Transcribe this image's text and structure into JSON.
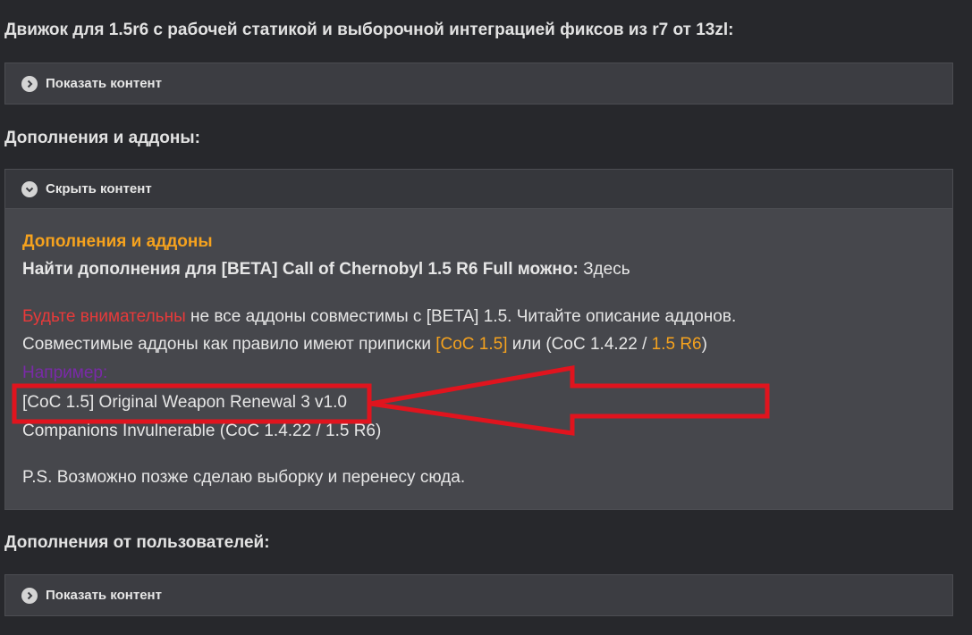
{
  "section1": {
    "heading": "Движок для 1.5r6 с рабочей статикой и выборочной интеграцией фиксов из r7 от 13zl:",
    "spoiler_label": "Показать контент"
  },
  "section2": {
    "heading": "Дополнения и аддоны:",
    "spoiler_label": "Скрыть контент",
    "content": {
      "title": "Дополнения и аддоны",
      "find_line": "Найти дополнения для [BETA] Call of Chernobyl 1.5 R6 Full можно:",
      "find_link": "Здесь",
      "warn_red": "Будьте внимательны",
      "warn_rest": " не все аддоны совместимы с [BETA] 1.5. Читайте описание аддонов.",
      "compat_text": "Совместимые аддоны как правило имеют приписки ",
      "compat_tag1": "[CoC 1.5]",
      "compat_mid": " или (CoC 1.4.22 / ",
      "compat_tag2": "1.5 R6",
      "compat_end": ")",
      "example_label": "Например:",
      "example1": "[CoC 1.5] Original Weapon Renewal 3 v1.0",
      "example2": "Companions Invulnerable (CoC 1.4.22 / 1.5 R6)",
      "ps": "P.S. Возможно позже сделаю выборку и перенесу сюда."
    }
  },
  "section3": {
    "heading": "Дополнения от пользователей:",
    "spoiler_label": "Показать контент"
  },
  "colors": {
    "background": "#27282c",
    "spoiler_bg": "#3c3d42",
    "content_bg": "#46474c",
    "orange": "#f5a21e",
    "red_text": "#e83a3a",
    "purple_text": "#7a2aa8",
    "annotation_red": "#e0141e"
  },
  "icons": {
    "spoiler_closed": "chevron-right-circle-icon",
    "spoiler_open": "chevron-down-circle-icon"
  }
}
